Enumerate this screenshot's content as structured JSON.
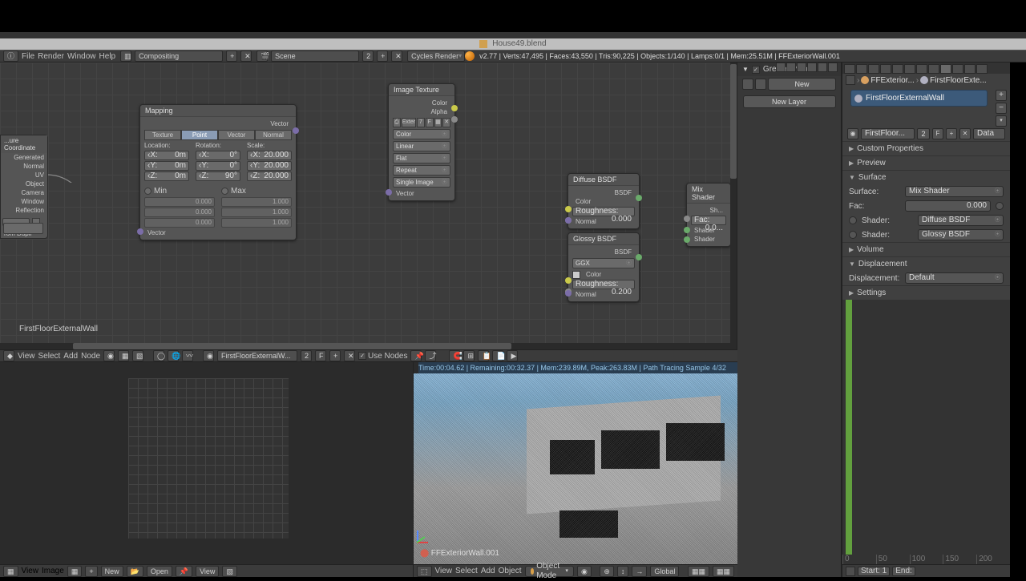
{
  "window": {
    "filename": "House49.blend"
  },
  "header": {
    "menus": [
      "File",
      "Render",
      "Window",
      "Help"
    ],
    "layout": "Compositing",
    "scene": "Scene",
    "engine": "Cycles Render",
    "stats": "v2.77 | Verts:47,495 | Faces:43,550 | Tris:90,225 | Objects:1/140 | Lamps:0/1 | Mem:25.51M | FFExteriorWall.001"
  },
  "grease": {
    "title": "Grease Pencil",
    "new": "New",
    "newLayer": "New Layer"
  },
  "props": {
    "crumb1": "FFExterior...",
    "crumb2": "FirstFloorExte...",
    "matname": "FirstFloorExternalWall",
    "matfield": "FirstFloor...",
    "matnum": "2",
    "matF": "F",
    "data": "Data",
    "sections": {
      "custom": "Custom Properties",
      "preview": "Preview",
      "surface": "Surface",
      "volume": "Volume",
      "displacement": "Displacement",
      "settings": "Settings"
    },
    "surface": {
      "surfaceLbl": "Surface:",
      "surfaceVal": "Mix Shader",
      "facLbl": "Fac:",
      "facVal": "0.000",
      "shader1Lbl": "Shader:",
      "shader1Val": "Diffuse BSDF",
      "shader2Lbl": "Shader:",
      "shader2Val": "Glossy BSDF"
    },
    "displacement": {
      "lbl": "Displacement:",
      "val": "Default"
    },
    "timelineTicks": [
      "0",
      "50",
      "100",
      "150",
      "200"
    ],
    "timelineStart": "Start:",
    "timelineEnd": "End:"
  },
  "nodeToolbar": {
    "menus": [
      "View",
      "Select",
      "Add",
      "Node"
    ],
    "material": "FirstFloorExternalW...",
    "matnum": "2",
    "matF": "F",
    "useNodes": "Use Nodes"
  },
  "nodeLabelText": "FirstFloorExternalWall",
  "texcoord": {
    "title": "...ure Coordinate",
    "outs": [
      "Generated",
      "Normal",
      "UV",
      "Object",
      "Camera",
      "Window",
      "Reflection"
    ],
    "fromDupli": "rom Dupli"
  },
  "mapping": {
    "title": "Mapping",
    "tabs": [
      "Texture",
      "Point",
      "Vector",
      "Normal"
    ],
    "cols": [
      "Location:",
      "Rotation:",
      "Scale:"
    ],
    "loc": [
      [
        "X:",
        "0m"
      ],
      [
        "Y:",
        "0m"
      ],
      [
        "Z:",
        "0m"
      ]
    ],
    "rot": [
      [
        "X:",
        "0°"
      ],
      [
        "Y:",
        "0°"
      ],
      [
        "Z:",
        "90°"
      ]
    ],
    "scl": [
      [
        "X:",
        "20.000"
      ],
      [
        "Y:",
        "20.000"
      ],
      [
        "Z:",
        "20.000"
      ]
    ],
    "min": "Min",
    "max": "Max",
    "minv": [
      "0.000",
      "0.000",
      "0.000"
    ],
    "maxv": [
      "1.000",
      "1.000",
      "1.000"
    ],
    "vectorOut": "Vector",
    "vectorIn": "Vector"
  },
  "imgtex": {
    "title": "Image Texture",
    "color": "Color",
    "alpha": "Alpha",
    "btns": [
      "⎙",
      "Exter",
      "7",
      "F",
      "▦",
      "✕"
    ],
    "dds": [
      "Color",
      "Linear",
      "Flat",
      "Repeat",
      "Single Image"
    ],
    "vector": "Vector"
  },
  "diffuse": {
    "title": "Diffuse BSDF",
    "bsdf": "BSDF",
    "rough": "Roughness:",
    "roughV": "0.000",
    "color": "Color",
    "normal": "Normal"
  },
  "glossy": {
    "title": "Glossy BSDF",
    "bsdf": "BSDF",
    "dd": "GGX",
    "rough": "Roughness:",
    "roughV": "0.200",
    "color": "Color",
    "normal": "Normal"
  },
  "mix": {
    "title": "Mix Shader",
    "out": "Sh...",
    "fac": "Fac:",
    "facV": "0.0...",
    "sh": "Shader"
  },
  "uvToolbar": {
    "view": "View",
    "image": "Image",
    "new": "New",
    "open": "Open",
    "view2": "View"
  },
  "renderStatus": "Time:00:04.62 | Remaining:00:32.37 | Mem:239.89M, Peak:263.83M | Path Tracing Sample 4/32",
  "renderObj": "FFExteriorWall.001",
  "renderToolbar": {
    "menus": [
      "View",
      "Select",
      "Add",
      "Object"
    ],
    "mode": "Object Mode",
    "global": "Global"
  }
}
